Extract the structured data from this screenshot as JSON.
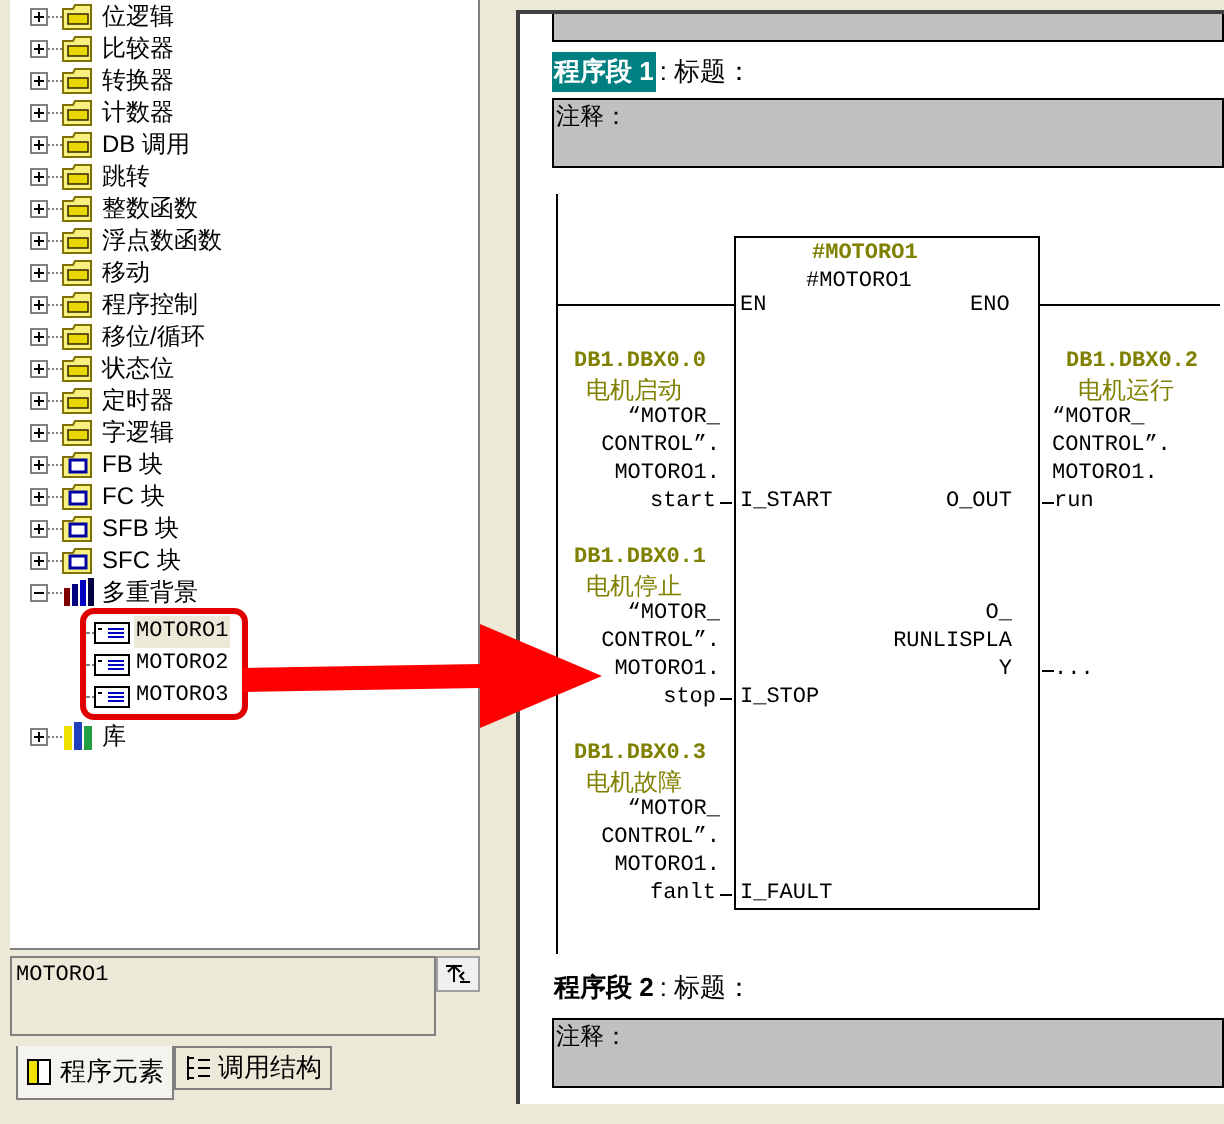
{
  "tree": [
    {
      "label": "位逻辑",
      "kind": "folder",
      "expanded": false
    },
    {
      "label": "比较器",
      "kind": "folder",
      "expanded": false
    },
    {
      "label": "转换器",
      "kind": "folder",
      "expanded": false
    },
    {
      "label": "计数器",
      "kind": "folder",
      "expanded": false
    },
    {
      "label": "DB 调用",
      "kind": "folder",
      "expanded": false
    },
    {
      "label": "跳转",
      "kind": "folder",
      "expanded": false
    },
    {
      "label": "整数函数",
      "kind": "folder",
      "expanded": false
    },
    {
      "label": "浮点数函数",
      "kind": "folder",
      "expanded": false
    },
    {
      "label": "移动",
      "kind": "folder",
      "expanded": false
    },
    {
      "label": "程序控制",
      "kind": "folder",
      "expanded": false
    },
    {
      "label": "移位/循环",
      "kind": "folder",
      "expanded": false
    },
    {
      "label": "状态位",
      "kind": "folder",
      "expanded": false
    },
    {
      "label": "定时器",
      "kind": "folder",
      "expanded": false
    },
    {
      "label": "字逻辑",
      "kind": "folder",
      "expanded": false
    },
    {
      "label": "FB 块",
      "kind": "block",
      "expanded": false
    },
    {
      "label": "FC 块",
      "kind": "block",
      "expanded": false
    },
    {
      "label": "SFB 块",
      "kind": "block",
      "expanded": false
    },
    {
      "label": "SFC 块",
      "kind": "block",
      "expanded": false
    },
    {
      "label": "多重背景",
      "kind": "multi",
      "expanded": true,
      "children": [
        {
          "label": "MOTORO1",
          "selected": true
        },
        {
          "label": "MOTORO2",
          "selected": false
        },
        {
          "label": "MOTORO3",
          "selected": false
        }
      ]
    },
    {
      "label": "库",
      "kind": "library",
      "expanded": false
    }
  ],
  "info_box": {
    "text": "MOTORO1"
  },
  "tabs": [
    {
      "label": "程序元素",
      "selected": true
    },
    {
      "label": "调用结构",
      "selected": false
    }
  ],
  "networks": [
    {
      "label": "程序段 1",
      "title": ": 标题：",
      "comment": "注释：",
      "selected": true
    },
    {
      "label": "程序段 2",
      "title": ": 标题：",
      "comment": "注释：",
      "selected": false
    }
  ],
  "block": {
    "instance_comment": "#MOTORO1",
    "instance_name": "#MOTORO1",
    "en": "EN",
    "eno": "ENO",
    "inputs": [
      {
        "address": "DB1.DBX0.0",
        "comment": "电机启动",
        "symbol_lines": [
          "“MOTOR_",
          "CONTROL”.",
          "MOTORO1."
        ],
        "operand": "start",
        "pin": "I_START"
      },
      {
        "address": "DB1.DBX0.1",
        "comment": "电机停止",
        "symbol_lines": [
          "“MOTOR_",
          "CONTROL”.",
          "MOTORO1."
        ],
        "operand": "stop",
        "pin": "I_STOP"
      },
      {
        "address": "DB1.DBX0.3",
        "comment": "电机故障",
        "symbol_lines": [
          "“MOTOR_",
          "CONTROL”.",
          "MOTORO1."
        ],
        "operand": "fanlt",
        "pin": "I_FAULT"
      }
    ],
    "outputs": [
      {
        "address": "DB1.DBX0.2",
        "comment": "电机运行",
        "symbol_lines": [
          "“MOTOR_",
          "CONTROL”.",
          "MOTORO1."
        ],
        "operand": "run",
        "pin_lines": [
          "O_OUT"
        ]
      },
      {
        "operand": "...",
        "pin_lines": [
          "O_",
          "RUNLISPLA",
          "Y"
        ]
      }
    ]
  }
}
